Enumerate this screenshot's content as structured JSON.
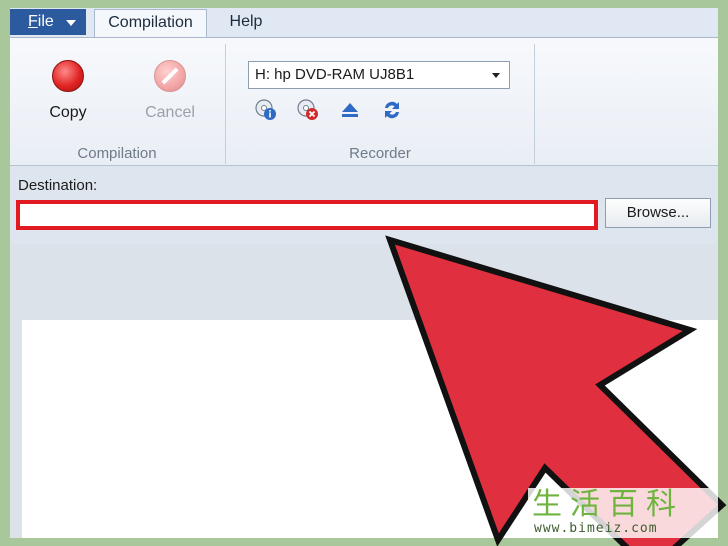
{
  "menubar": {
    "file_label_first": "F",
    "file_label_rest": "ile",
    "tabs": [
      {
        "label": "Compilation",
        "active": true
      },
      {
        "label": "Help",
        "active": false
      }
    ]
  },
  "ribbon": {
    "compilation_group": {
      "label": "Compilation",
      "copy_label": "Copy",
      "cancel_label": "Cancel"
    },
    "recorder_group": {
      "label": "Recorder",
      "drive_selected": "H: hp DVD-RAM UJ8B1",
      "icons": [
        "disc-info-icon",
        "disc-erase-icon",
        "eject-icon",
        "refresh-icon"
      ]
    }
  },
  "destination": {
    "label": "Destination:",
    "value": "",
    "browse_label": "Browse..."
  },
  "annotation": {
    "arrow_color": "#e0303f",
    "highlight_color": "#e11a22"
  },
  "watermark": {
    "title": "生活百科",
    "url": "www.bimeiz.com"
  }
}
